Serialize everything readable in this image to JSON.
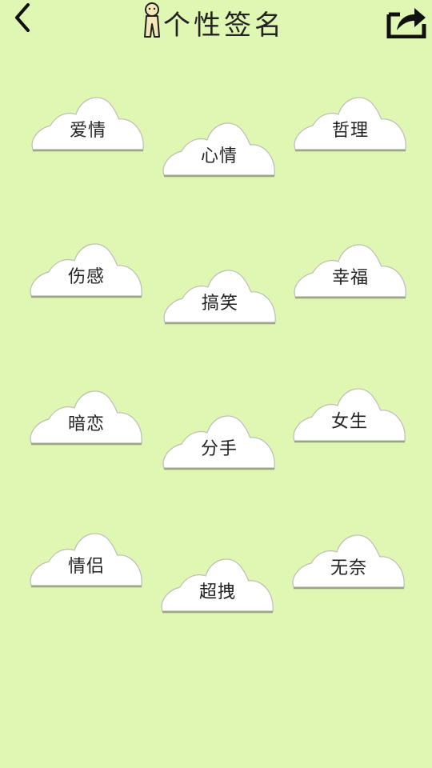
{
  "header": {
    "title": "个性签名",
    "back_icon": "chevron-left-icon",
    "share_icon": "share-icon"
  },
  "colors": {
    "background": "#e0f7b4",
    "cloud": "#ffffff",
    "text": "#222222"
  },
  "categories": [
    {
      "label": "爱情"
    },
    {
      "label": "心情"
    },
    {
      "label": "哲理"
    },
    {
      "label": "伤感"
    },
    {
      "label": "搞笑"
    },
    {
      "label": "幸福"
    },
    {
      "label": "暗恋"
    },
    {
      "label": "分手"
    },
    {
      "label": "女生"
    },
    {
      "label": "情侣"
    },
    {
      "label": "超拽"
    },
    {
      "label": "无奈"
    }
  ]
}
